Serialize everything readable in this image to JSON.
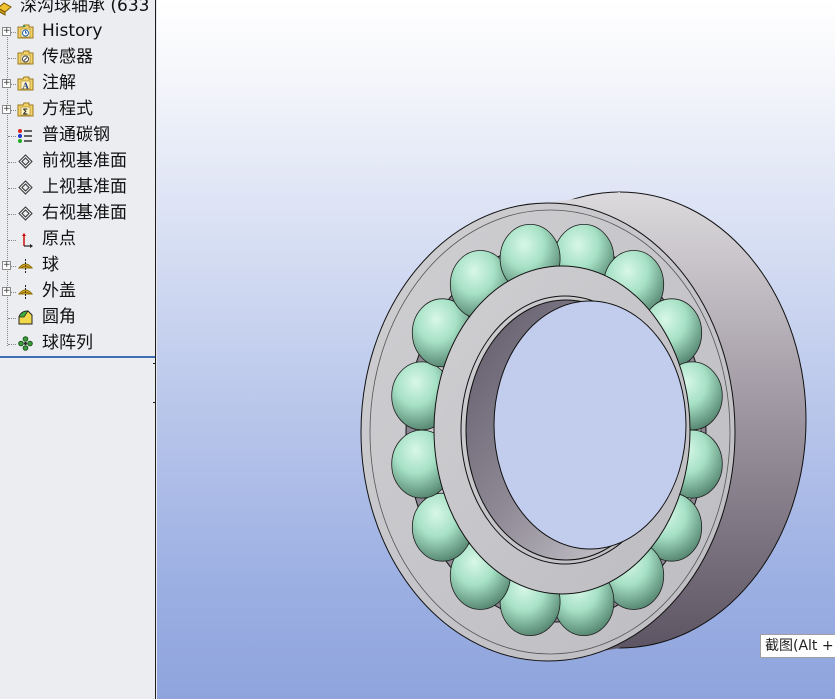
{
  "feature_tree": {
    "root": {
      "label": "深沟球轴承 (633",
      "icon": "part-icon"
    },
    "items": [
      {
        "label": "History",
        "icon": "history-folder-icon",
        "expandable": true
      },
      {
        "label": "传感器",
        "icon": "sensor-folder-icon",
        "expandable": false
      },
      {
        "label": "注解",
        "icon": "annotation-folder-icon",
        "expandable": true
      },
      {
        "label": "方程式",
        "icon": "equation-folder-icon",
        "expandable": true
      },
      {
        "label": "普通碳钢",
        "icon": "material-icon",
        "expandable": false
      },
      {
        "label": "前视基准面",
        "icon": "plane-icon",
        "expandable": false
      },
      {
        "label": "上视基准面",
        "icon": "plane-icon",
        "expandable": false
      },
      {
        "label": "右视基准面",
        "icon": "plane-icon",
        "expandable": false
      },
      {
        "label": "原点",
        "icon": "origin-icon",
        "expandable": false
      },
      {
        "label": "球",
        "icon": "revolve-feature-icon",
        "expandable": true
      },
      {
        "label": "外盖",
        "icon": "revolve-feature-icon",
        "expandable": true
      },
      {
        "label": "圆角",
        "icon": "fillet-icon",
        "expandable": false
      },
      {
        "label": "球阵列",
        "icon": "circular-pattern-icon",
        "expandable": false
      }
    ]
  },
  "viewport": {
    "model": "deep-groove-ball-bearing",
    "ball_count": 16,
    "colors": {
      "ring": "#c9c8cc",
      "ball": "#a8e3c8",
      "bg_top": "#ffffff",
      "bg_bottom": "#8fa4dc"
    }
  },
  "tooltip": {
    "text": "截图(Alt +"
  }
}
